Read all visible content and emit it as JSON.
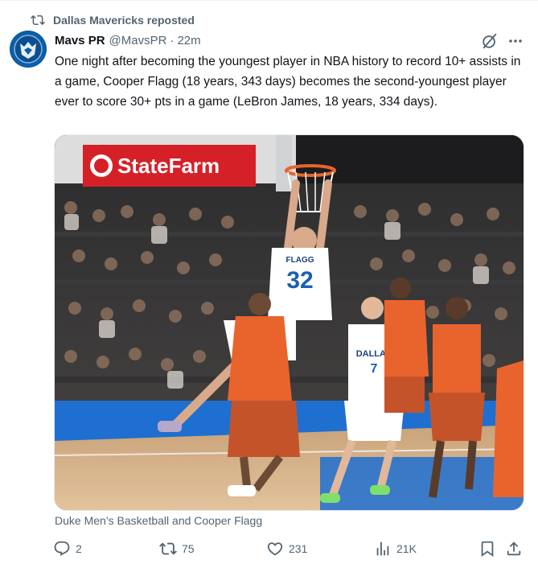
{
  "repost": {
    "label": "Dallas Mavericks reposted",
    "icon": "repost-icon"
  },
  "post": {
    "author_name": "Mavs PR",
    "handle": "@MavsPR",
    "separator": "·",
    "time": "22m",
    "text": "One night after becoming the youngest player in NBA history to record 10+ assists in a game, Cooper Flagg (18 years, 343 days) becomes the second-youngest player ever to score 30+ pts in a game (LeBron James, 18 years, 334 days).",
    "media": {
      "banner_text": "StateFarm",
      "jersey_front_name": "FLAGG",
      "jersey_front_number": "32",
      "jersey_second_team": "DALLAS",
      "jersey_second_number": "7"
    },
    "caption": "Duke Men’s Basketball and Cooper Flagg"
  },
  "actions": {
    "replies": "2",
    "reposts": "75",
    "likes": "231",
    "views": "21K"
  },
  "colors": {
    "text_primary": "#0f1419",
    "text_secondary": "#536471",
    "mavs_blue": "#0b5ea8",
    "banner_red": "#d62027",
    "court_blue": "#1f6fd0",
    "thunder_orange": "#e9642d"
  }
}
